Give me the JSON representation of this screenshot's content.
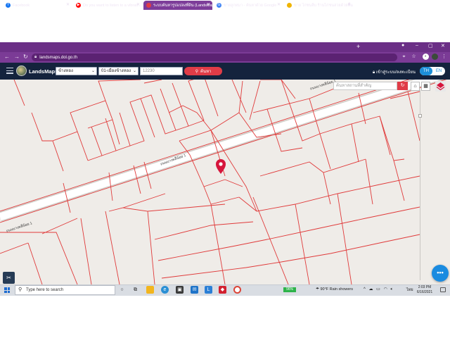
{
  "browser": {
    "tabs": [
      {
        "title": "Facebook",
        "favicon": "facebook-icon",
        "color": "#1877f2",
        "active": false
      },
      {
        "title": "Do you want to listen to a vibrati...",
        "favicon": "youtube-icon",
        "color": "#ff0000",
        "active": false
      },
      {
        "title": "ระบบค้นหารูปแปลงที่ดิน (LandsMap...",
        "favicon": "map-pin-icon",
        "color": "#e03c47",
        "active": true
      },
      {
        "title": "ขายลูกหมา - ค้นหาด้วย Google",
        "favicon": "google-icon",
        "color": "#4285f4",
        "active": false
      },
      {
        "title": "ขาย ไก่ชนลีบ ร้านไก่ชนสวยด้วยพื้น ห้าง",
        "favicon": "paw-icon",
        "color": "#f0b400",
        "active": false
      }
    ],
    "url": "landsmaps.dol.go.th"
  },
  "landsmaps": {
    "brand": "LandsMaps",
    "province": "ข้างหอง",
    "district": "01-เมืองข้างหอง",
    "parcel_value": "12230",
    "search_label": "ค้นหา",
    "login_label": "เข้าสู่ระบบ/ลงทะเบียน",
    "lang_th": "TH",
    "lang_en": "EN",
    "place_search_placeholder": "ค้นหาสถานที่สำคัญ",
    "fab_label": "•••"
  },
  "map": {
    "road_labels": [
      {
        "text": "ถนนบางพลีน้อย 1"
      },
      {
        "text": "ถนนบางพลีน้อย 1"
      },
      {
        "text": "ถนนบางพลีน้อย 1"
      }
    ],
    "line_color": "#e03a3a",
    "road_color": "#ffffff",
    "marker_color": "#d6163c"
  },
  "taskbar": {
    "search_placeholder": "Type here to search",
    "battery": "96%",
    "weather": "90°F  Rain showers",
    "ime": "ไทย",
    "time": "2:03 PM",
    "date": "6/16/2021"
  }
}
